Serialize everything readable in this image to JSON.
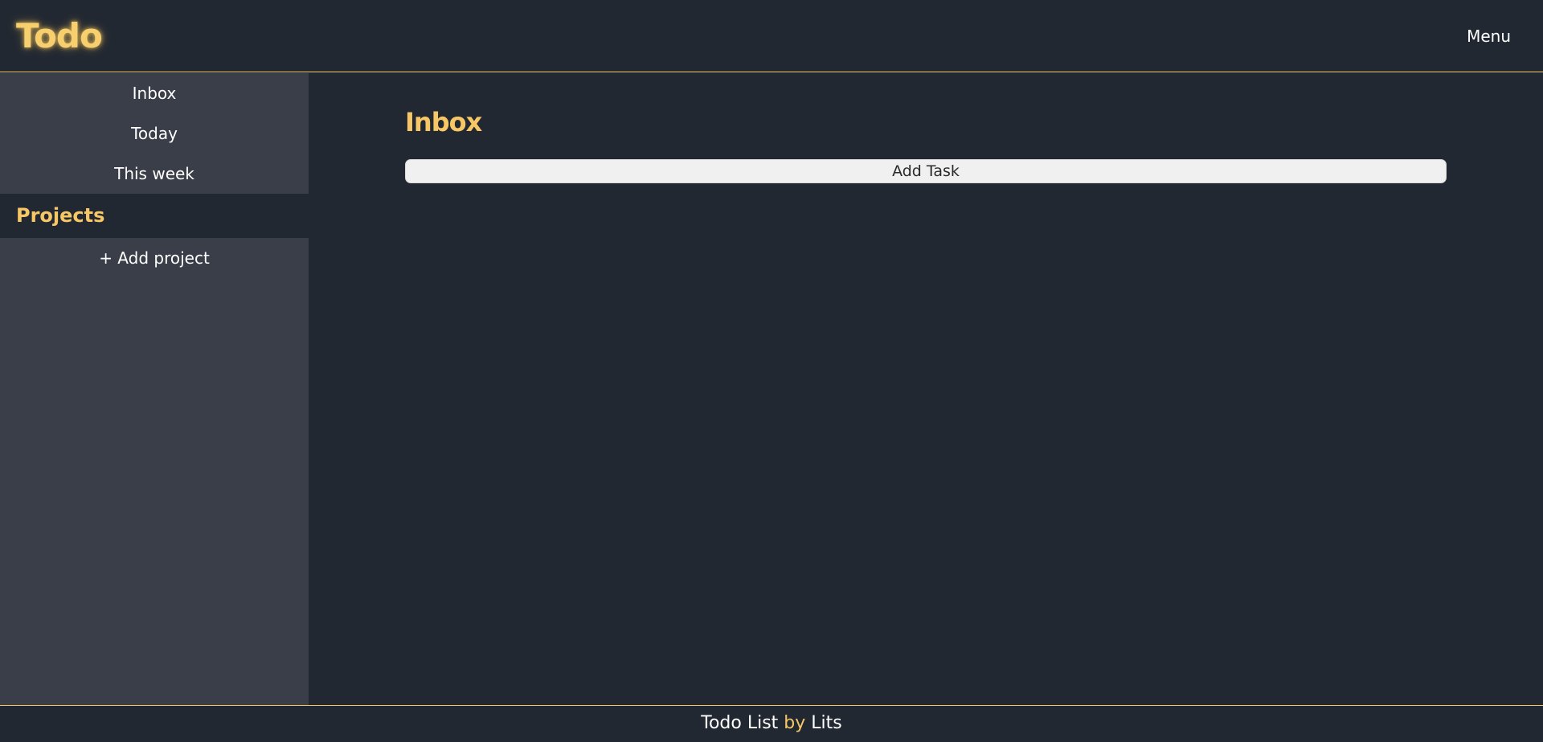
{
  "header": {
    "logo": "Todo",
    "menu_label": "Menu"
  },
  "sidebar": {
    "items": [
      {
        "label": "Inbox"
      },
      {
        "label": "Today"
      },
      {
        "label": "This week"
      }
    ],
    "projects_title": "Projects",
    "add_project_label": "+ Add project"
  },
  "main": {
    "title": "Inbox",
    "add_task_label": "Add Task"
  },
  "footer": {
    "part1": "Todo List",
    "part2": "by",
    "part3": "Lits"
  },
  "colors": {
    "background": "#222832",
    "sidebar": "#3a3e48",
    "accent": "#f7c766",
    "button": "#f0f0f0"
  }
}
